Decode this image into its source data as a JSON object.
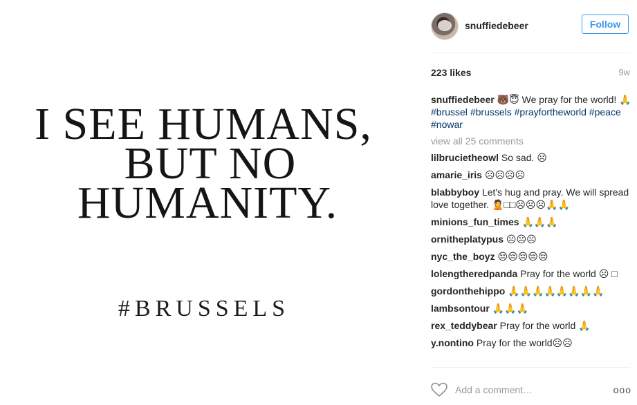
{
  "photo": {
    "line1": "I SEE HUMANS,",
    "line2": "BUT NO",
    "line3": "HUMANITY.",
    "tag": "#BRUSSELS"
  },
  "header": {
    "username": "snuffiedebeer",
    "follow_label": "Follow"
  },
  "stats": {
    "likes": "223 likes",
    "time": "9w"
  },
  "caption": {
    "user": "snuffiedebeer",
    "text": "🐻😇 We pray for the world! 🙏",
    "hashtags": [
      "#brussel",
      "#brussels",
      "#prayfortheworld",
      "#peace",
      "#nowar"
    ]
  },
  "view_all": "view all 25 comments",
  "comments": [
    {
      "user": "lilbrucietheowl",
      "text": "So sad. ☹"
    },
    {
      "user": "amarie_iris",
      "text": "☹☹☹☹"
    },
    {
      "user": "blabbyboy",
      "text": "Let's hug and pray. We will spread love together. 🙎□□☹☹☹🙏🙏"
    },
    {
      "user": "minions_fun_times",
      "text": "🙏🙏🙏"
    },
    {
      "user": "ornitheplatypus",
      "text": "☹☹☹"
    },
    {
      "user": "nyc_the_boyz",
      "text": "😔😔😔😔😔"
    },
    {
      "user": "lolengtheredpanda",
      "text": "Pray for the world ☹ □"
    },
    {
      "user": "gordonthehippo",
      "text": "🙏🙏🙏🙏🙏🙏🙏🙏"
    },
    {
      "user": "lambsontour",
      "text": "🙏🙏🙏"
    },
    {
      "user": "rex_teddybear",
      "text": "Pray for the world 🙏"
    },
    {
      "user": "y.nontino",
      "text": "Pray for the world☹☹"
    }
  ],
  "footer": {
    "add_comment_placeholder": "Add a comment…",
    "more_label": "ooo"
  },
  "colors": {
    "accent": "#3897f0",
    "hashtag": "#003569",
    "muted": "#999999"
  },
  "icons": {
    "like": "heart-icon",
    "more": "more-options-icon"
  }
}
